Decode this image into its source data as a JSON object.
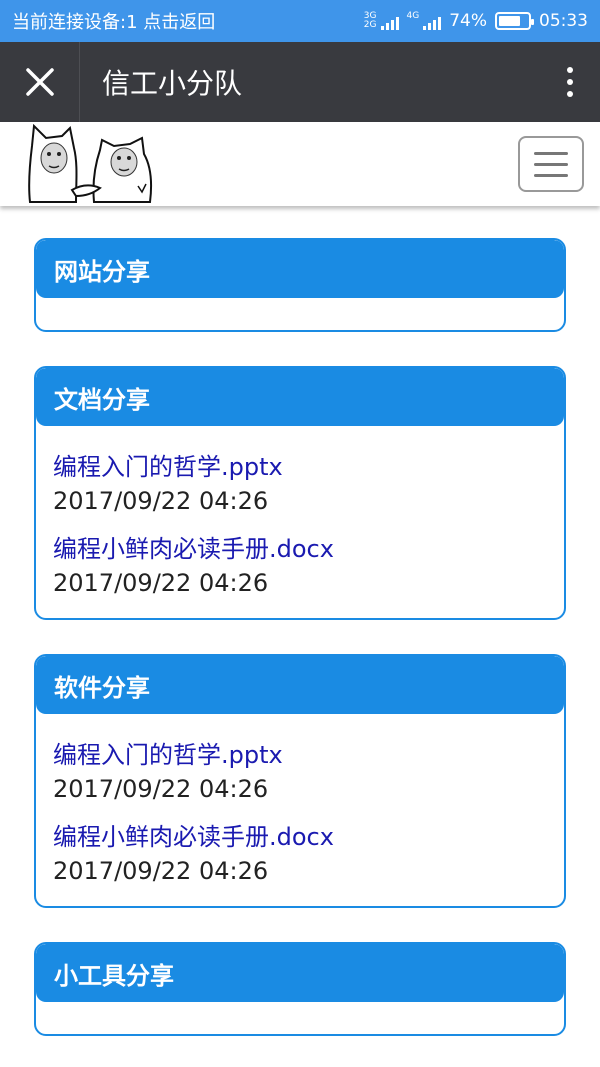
{
  "status_bar": {
    "left_text": "当前连接设备:1 点击返回",
    "net1_top": "3G",
    "net1_bottom": "2G",
    "net2_top": "4G",
    "battery": "74%",
    "battery_level": 0.74,
    "time": "05:33"
  },
  "title_bar": {
    "title": "信工小分队",
    "close_icon": "close-icon",
    "more_icon": "more-vertical-icon"
  },
  "header": {
    "logo": "cartoon-cats-handshake-logo",
    "menu_icon": "hamburger-menu-icon"
  },
  "sections": [
    {
      "title": "网站分享",
      "files": []
    },
    {
      "title": "文档分享",
      "files": [
        {
          "name": "编程入门的哲学.pptx",
          "date": "2017/09/22 04:26"
        },
        {
          "name": "编程小鲜肉必读手册.docx",
          "date": "2017/09/22 04:26"
        }
      ]
    },
    {
      "title": "软件分享",
      "files": [
        {
          "name": "编程入门的哲学.pptx",
          "date": "2017/09/22 04:26"
        },
        {
          "name": "编程小鲜肉必读手册.docx",
          "date": "2017/09/22 04:26"
        }
      ]
    },
    {
      "title": "小工具分享",
      "files": []
    }
  ],
  "colors": {
    "status_bar": "#3f95ea",
    "title_bar": "#393a3f",
    "accent": "#1a8be3",
    "link": "#1a1ab0"
  }
}
